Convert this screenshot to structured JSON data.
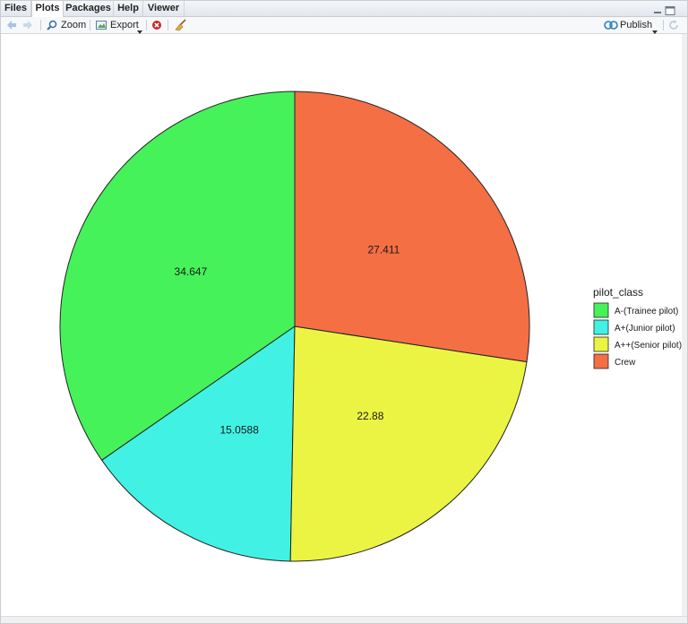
{
  "tabs": [
    {
      "label": "Files",
      "active": false
    },
    {
      "label": "Plots",
      "active": true
    },
    {
      "label": "Packages",
      "active": false
    },
    {
      "label": "Help",
      "active": false
    },
    {
      "label": "Viewer",
      "active": false
    }
  ],
  "toolbar": {
    "back_icon": "arrow-left-icon",
    "forward_icon": "arrow-right-icon",
    "zoom_label": "Zoom",
    "export_label": "Export",
    "remove_icon": "remove-plot-icon",
    "clear_icon": "broom-icon",
    "publish_label": "Publish",
    "refresh_icon": "refresh-icon"
  },
  "chart_data": {
    "type": "pie",
    "categories": [
      "A-(Trainee pilot)",
      "A+(Junior pilot)",
      "A++(Senior pilot)",
      "Crew"
    ],
    "values": [
      34.647,
      15.0588,
      22.88,
      27.411
    ],
    "labels": [
      "34.647",
      "15.0588",
      "22.88",
      "27.411"
    ],
    "colors": [
      "#45f25a",
      "#41f2e4",
      "#ebf443",
      "#f46f43"
    ],
    "legend_title": "pilot_class",
    "legend_position": "right",
    "start": "12 o'clock",
    "direction": "counter-clockwise"
  }
}
